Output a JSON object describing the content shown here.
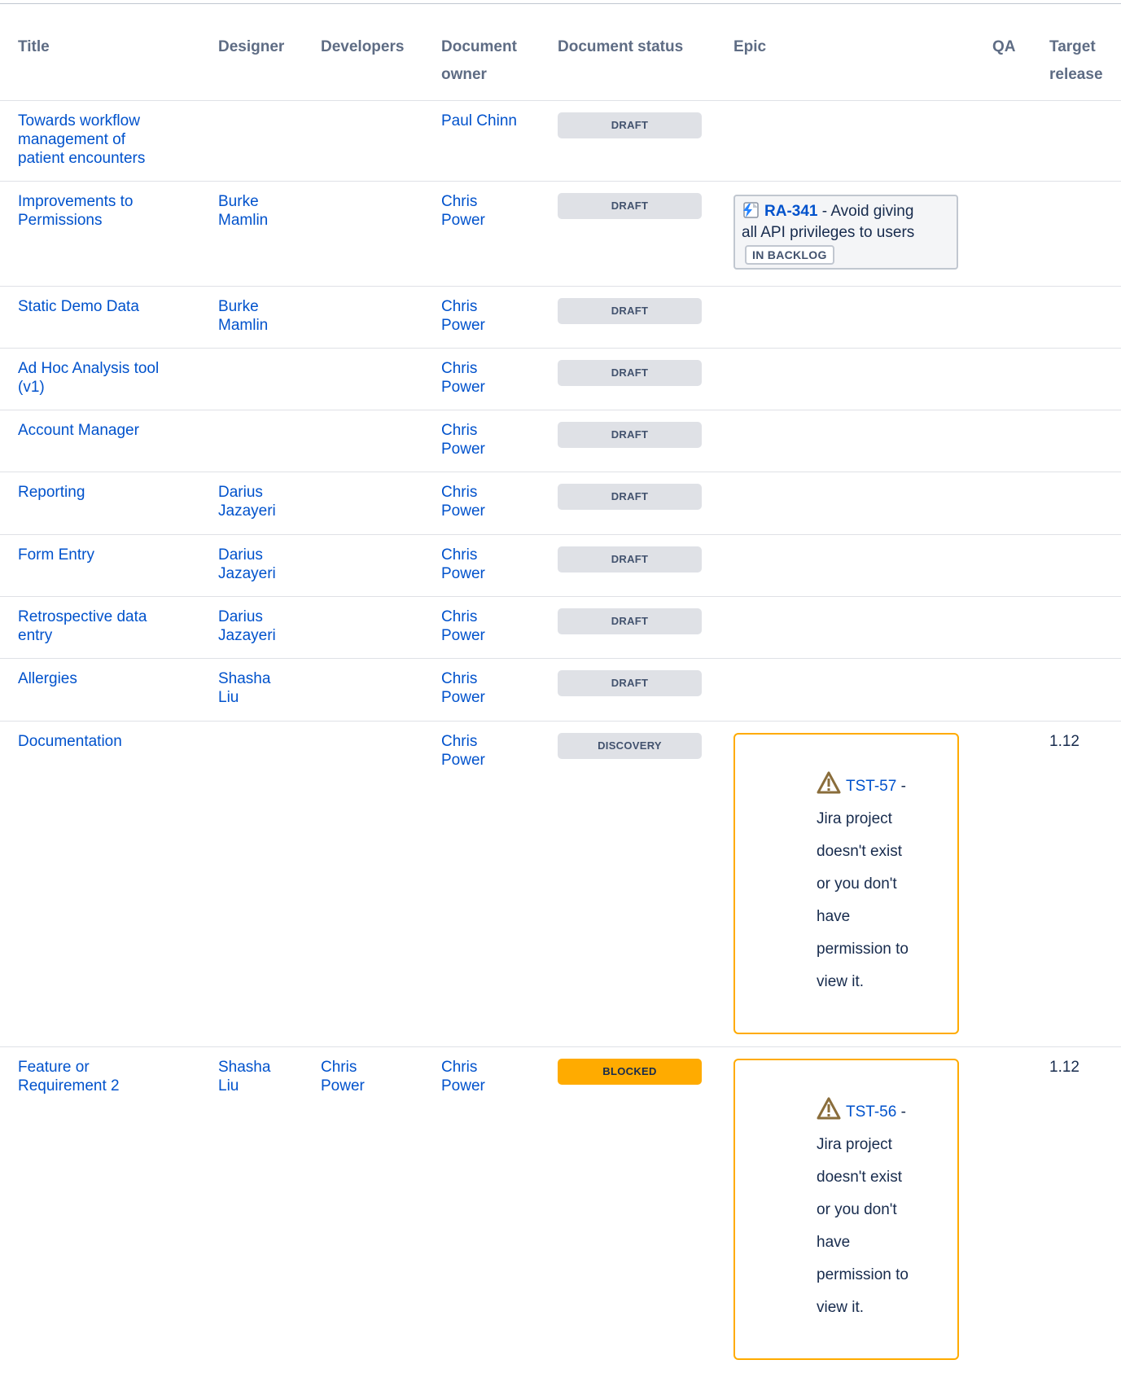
{
  "columns": [
    "Title",
    "Designer",
    "Developers",
    "Document owner",
    "Document status",
    "Epic",
    "QA",
    "Target release"
  ],
  "header_lines": {
    "document_owner": [
      "Document",
      "owner"
    ],
    "target_release": [
      "Target",
      "release"
    ]
  },
  "rows": [
    {
      "title": [
        "Towards workflow",
        "management of",
        "patient encounters"
      ],
      "designer": [],
      "developers": [],
      "owner": [
        "Paul Chinn"
      ],
      "status": "DRAFT",
      "epic": null,
      "qa": "",
      "target_release": ""
    },
    {
      "title": [
        "Improvements to",
        "Permissions"
      ],
      "designer": [
        "Burke",
        "Mamlin"
      ],
      "developers": [],
      "owner": [
        "Chris",
        "Power"
      ],
      "status": "DRAFT",
      "epic": {
        "type": "issue",
        "icon": "epic-icon",
        "key": "RA-341",
        "summary_line1": " - Avoid giving",
        "summary_line2": "all API privileges to users",
        "status": "IN BACKLOG"
      },
      "qa": "",
      "target_release": ""
    },
    {
      "title": [
        "Static Demo Data"
      ],
      "designer": [
        "Burke",
        "Mamlin"
      ],
      "developers": [],
      "owner": [
        "Chris",
        "Power"
      ],
      "status": "DRAFT",
      "epic": null,
      "qa": "",
      "target_release": ""
    },
    {
      "title": [
        "Ad Hoc Analysis tool",
        "(v1)"
      ],
      "designer": [],
      "developers": [],
      "owner": [
        "Chris",
        "Power"
      ],
      "status": "DRAFT",
      "epic": null,
      "qa": "",
      "target_release": ""
    },
    {
      "title": [
        "Account Manager"
      ],
      "designer": [],
      "developers": [],
      "owner": [
        "Chris",
        "Power"
      ],
      "status": "DRAFT",
      "epic": null,
      "qa": "",
      "target_release": ""
    },
    {
      "title": [
        "Reporting"
      ],
      "designer": [
        "Darius",
        "Jazayeri"
      ],
      "developers": [],
      "owner": [
        "Chris",
        "Power"
      ],
      "status": "DRAFT",
      "epic": null,
      "qa": "",
      "target_release": ""
    },
    {
      "title": [
        "Form Entry"
      ],
      "designer": [
        "Darius",
        "Jazayeri"
      ],
      "developers": [],
      "owner": [
        "Chris",
        "Power"
      ],
      "status": "DRAFT",
      "epic": null,
      "qa": "",
      "target_release": ""
    },
    {
      "title": [
        "Retrospective data",
        "entry"
      ],
      "designer": [
        "Darius",
        "Jazayeri"
      ],
      "developers": [],
      "owner": [
        "Chris",
        "Power"
      ],
      "status": "DRAFT",
      "epic": null,
      "qa": "",
      "target_release": ""
    },
    {
      "title": [
        "Allergies"
      ],
      "designer": [
        "Shasha",
        "Liu"
      ],
      "developers": [],
      "owner": [
        "Chris",
        "Power"
      ],
      "status": "DRAFT",
      "epic": null,
      "qa": "",
      "target_release": ""
    },
    {
      "title": [
        "Documentation"
      ],
      "designer": [],
      "developers": [],
      "owner": [
        "Chris",
        "Power"
      ],
      "status": "DISCOVERY",
      "epic": {
        "type": "warning",
        "icon": "warning-icon",
        "key": "TST-57",
        "lines": [
          " -",
          "Jira project",
          "doesn't exist",
          "or you don't",
          "have",
          "permission to",
          "view it."
        ]
      },
      "qa": "",
      "target_release": "1.12"
    },
    {
      "title": [
        "Feature or",
        "Requirement 2"
      ],
      "designer": [
        "Shasha",
        "Liu"
      ],
      "developers": [
        "Chris",
        "Power"
      ],
      "owner": [
        "Chris",
        "Power"
      ],
      "status": "BLOCKED",
      "epic": {
        "type": "warning",
        "icon": "warning-icon",
        "key": "TST-56",
        "lines": [
          " -",
          "Jira project",
          "doesn't exist",
          "or you don't",
          "have",
          "permission to",
          "view it."
        ]
      },
      "qa": "",
      "target_release": "1.12"
    }
  ],
  "colors": {
    "link": "#0052cc",
    "header_text": "#5e6c84",
    "lozenge_default": "#dfe1e6",
    "lozenge_blocked": "#ffab00",
    "warning_border": "#ffab00"
  }
}
